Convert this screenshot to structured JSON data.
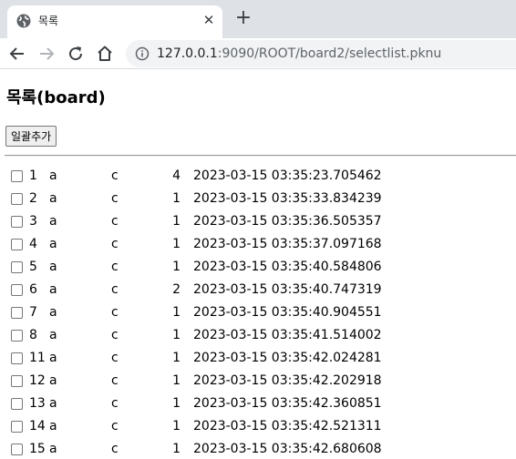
{
  "browser": {
    "tab_title": "목록",
    "tab_close": "✕",
    "new_tab": "+",
    "url_host": "127.0.0.1",
    "url_rest": ":9090/ROOT/board2/selectlist.pknu"
  },
  "page": {
    "title": "목록(board)",
    "bulk_add_label": "일괄추가"
  },
  "rows": [
    {
      "no": "1",
      "title": "a",
      "writer": "c",
      "count": "4",
      "date": "2023-03-15 03:35:23.705462"
    },
    {
      "no": "2",
      "title": "a",
      "writer": "c",
      "count": "1",
      "date": "2023-03-15 03:35:33.834239"
    },
    {
      "no": "3",
      "title": "a",
      "writer": "c",
      "count": "1",
      "date": "2023-03-15 03:35:36.505357"
    },
    {
      "no": "4",
      "title": "a",
      "writer": "c",
      "count": "1",
      "date": "2023-03-15 03:35:37.097168"
    },
    {
      "no": "5",
      "title": "a",
      "writer": "c",
      "count": "1",
      "date": "2023-03-15 03:35:40.584806"
    },
    {
      "no": "6",
      "title": "a",
      "writer": "c",
      "count": "2",
      "date": "2023-03-15 03:35:40.747319"
    },
    {
      "no": "7",
      "title": "a",
      "writer": "c",
      "count": "1",
      "date": "2023-03-15 03:35:40.904551"
    },
    {
      "no": "8",
      "title": "a",
      "writer": "c",
      "count": "1",
      "date": "2023-03-15 03:35:41.514002"
    },
    {
      "no": "11",
      "title": "a",
      "writer": "c",
      "count": "1",
      "date": "2023-03-15 03:35:42.024281"
    },
    {
      "no": "12",
      "title": "a",
      "writer": "c",
      "count": "1",
      "date": "2023-03-15 03:35:42.202918"
    },
    {
      "no": "13",
      "title": "a",
      "writer": "c",
      "count": "1",
      "date": "2023-03-15 03:35:42.360851"
    },
    {
      "no": "14",
      "title": "a",
      "writer": "c",
      "count": "1",
      "date": "2023-03-15 03:35:42.521311"
    },
    {
      "no": "15",
      "title": "a",
      "writer": "c",
      "count": "1",
      "date": "2023-03-15 03:35:42.680608"
    }
  ]
}
